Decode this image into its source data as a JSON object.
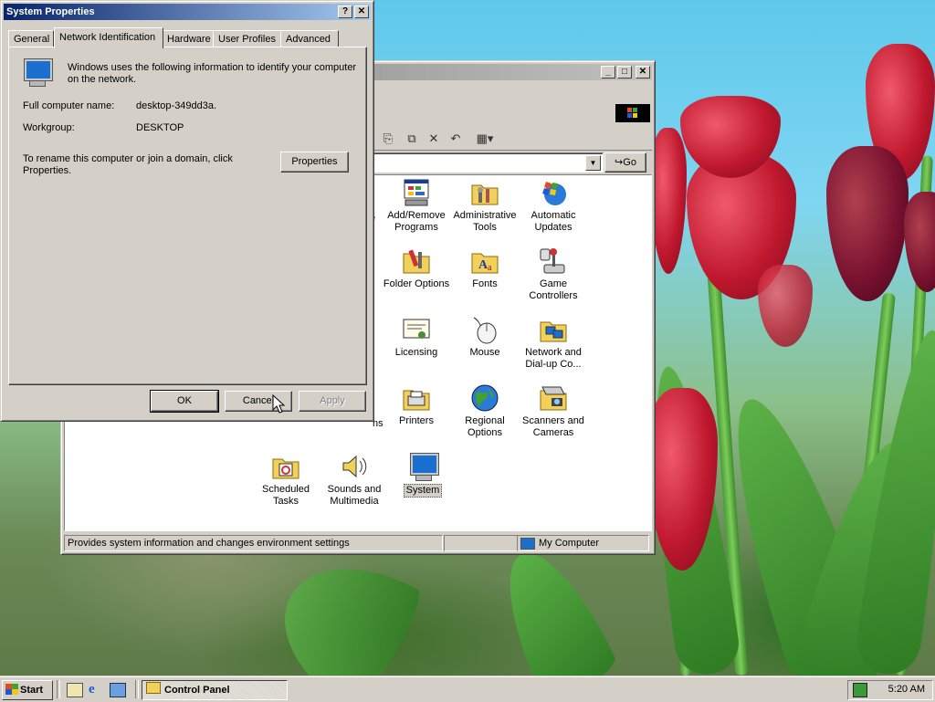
{
  "system_properties": {
    "title": "System Properties",
    "help_btn": "?",
    "close_btn": "✕",
    "tabs": [
      "General",
      "Network Identification",
      "Hardware",
      "User Profiles",
      "Advanced"
    ],
    "selected_tab": "Network Identification",
    "description": "Windows uses the following information to identify your computer on the network.",
    "full_name_label": "Full computer name:",
    "full_name_value": "desktop-349dd3a.",
    "workgroup_label": "Workgroup:",
    "workgroup_value": "DESKTOP",
    "rename_text": "To rename this computer or join a domain, click Properties.",
    "properties_btn": "Properties",
    "ok_btn": "OK",
    "cancel_btn": "Cancel",
    "apply_btn": "Apply"
  },
  "control_panel": {
    "min_btn": "_",
    "max_btn": "□",
    "close_btn": "✕",
    "go_label": "Go",
    "status_text": "Provides system information and changes environment settings",
    "status_location": "My Computer",
    "partial_labels": [
      "e",
      "ns"
    ],
    "items": [
      {
        "label": "Add/Remove Programs",
        "icon": "add-remove-programs-icon"
      },
      {
        "label": "Administrative Tools",
        "icon": "administrative-tools-icon"
      },
      {
        "label": "Automatic Updates",
        "icon": "automatic-updates-icon"
      },
      {
        "label": "Folder Options",
        "icon": "folder-options-icon"
      },
      {
        "label": "Fonts",
        "icon": "fonts-icon"
      },
      {
        "label": "Game Controllers",
        "icon": "game-controllers-icon"
      },
      {
        "label": "Licensing",
        "icon": "licensing-icon"
      },
      {
        "label": "Mouse",
        "icon": "mouse-icon"
      },
      {
        "label": "Network and Dial-up Co...",
        "icon": "network-dialup-icon"
      },
      {
        "label": "Printers",
        "icon": "printers-icon"
      },
      {
        "label": "Regional Options",
        "icon": "regional-options-icon"
      },
      {
        "label": "Scanners and Cameras",
        "icon": "scanners-cameras-icon"
      },
      {
        "label": "Scheduled Tasks",
        "icon": "scheduled-tasks-icon"
      },
      {
        "label": "Sounds and Multimedia",
        "icon": "sounds-multimedia-icon"
      },
      {
        "label": "System",
        "icon": "system-icon",
        "selected": true
      }
    ]
  },
  "taskbar": {
    "start_label": "Start",
    "task_label": "Control Panel",
    "clock": "5:20 AM"
  }
}
